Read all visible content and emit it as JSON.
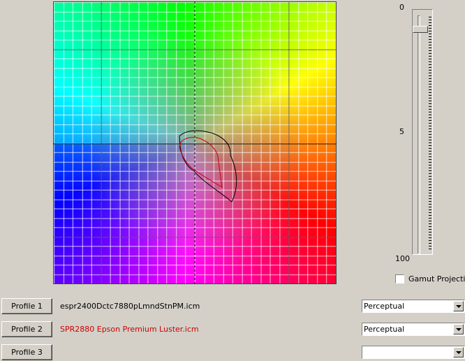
{
  "scale": {
    "top": "0",
    "middle": "5",
    "bottom": "100"
  },
  "slider": {
    "value": 0
  },
  "checkbox": {
    "label": "Gamut Projection",
    "checked": false
  },
  "profiles": [
    {
      "button": "Profile 1",
      "name": "espr2400Dctc7880pLmndStnPM.icm",
      "name_color": "#000000",
      "intent": "Perceptual",
      "outline_color": "#000000"
    },
    {
      "button": "Profile 2",
      "name": "SPR2880 Epson Premium Luster.icm",
      "name_color": "#cc0000",
      "intent": "Perceptual",
      "outline_color": "#cc0000"
    },
    {
      "button": "Profile 3",
      "name": "",
      "name_color": "#000000",
      "intent": ""
    }
  ]
}
